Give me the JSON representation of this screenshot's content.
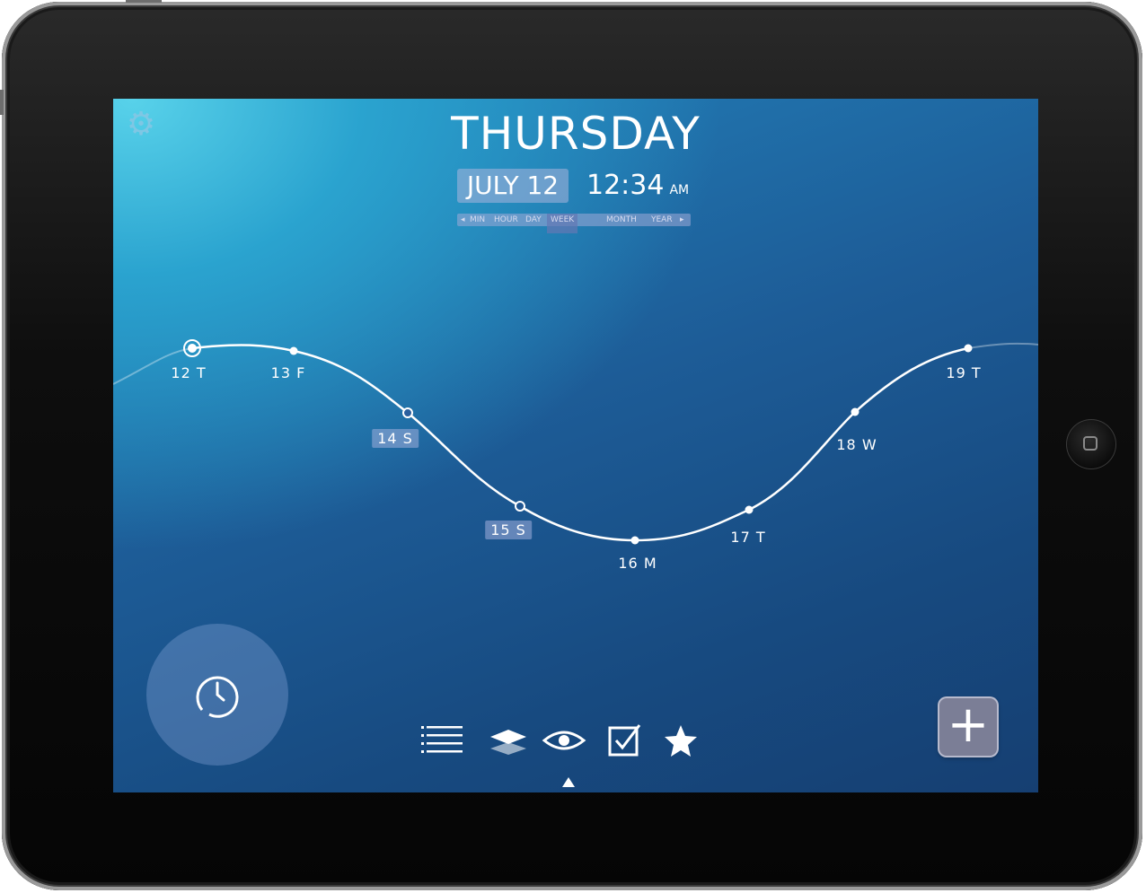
{
  "header": {
    "day": "THURSDAY",
    "date": "JULY 12",
    "time": "12:34",
    "ampm": "AM"
  },
  "scale": {
    "options": [
      "MIN",
      "HOUR",
      "DAY",
      "WEEK",
      "MONTH",
      "YEAR"
    ],
    "selected": "WEEK"
  },
  "timeline": {
    "days": [
      {
        "label": "12 T",
        "selected": true,
        "style": "current"
      },
      {
        "label": "13 F",
        "style": "plain"
      },
      {
        "label": "14 S",
        "style": "boxed"
      },
      {
        "label": "15 S",
        "style": "boxed"
      },
      {
        "label": "16 M",
        "style": "plain"
      },
      {
        "label": "17 T",
        "style": "plain"
      },
      {
        "label": "18 W",
        "style": "plain"
      },
      {
        "label": "19 T",
        "style": "plain"
      }
    ]
  },
  "toolbar": {
    "items": [
      "list-icon",
      "layers-icon",
      "eye-icon",
      "checkbox-icon",
      "star-icon"
    ],
    "active": "eye-icon"
  },
  "icons": {
    "settings": "gear-icon",
    "timer": "clock-icon",
    "add": "plus-icon"
  },
  "colors": {
    "background_top": "#58d2ea",
    "background_bottom": "#163f72",
    "accent_box": "#aab4dc",
    "add_button": "#7b7e96"
  }
}
